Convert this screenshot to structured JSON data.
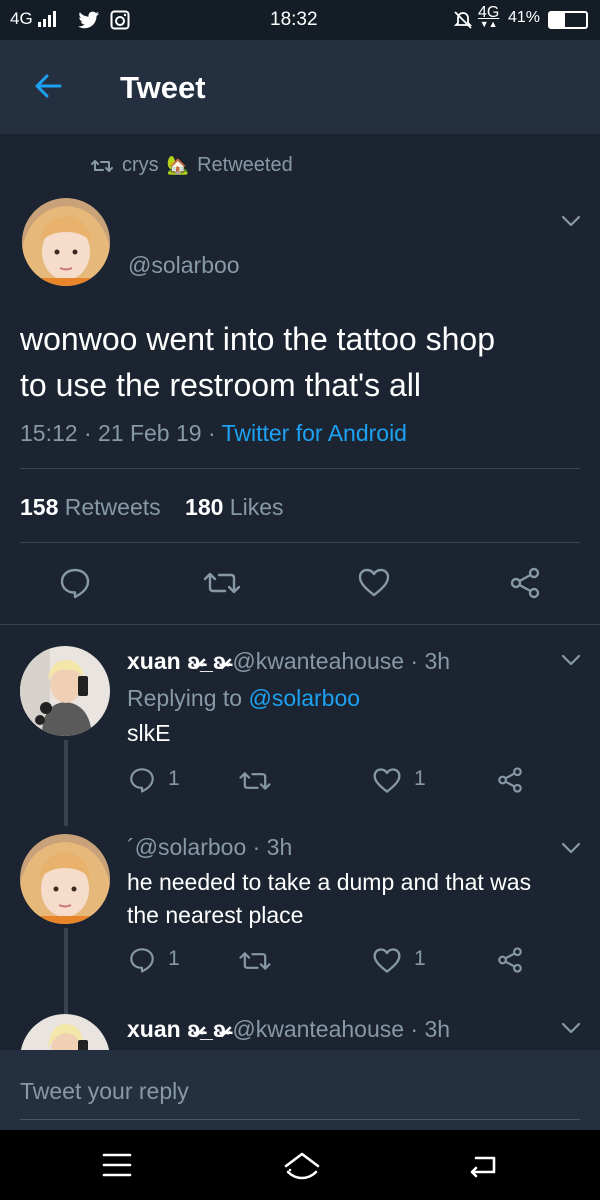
{
  "status_bar": {
    "network_left": "4G",
    "time": "18:32",
    "network_right": "4G",
    "battery": "41%"
  },
  "header": {
    "title": "Tweet"
  },
  "retweet_context": {
    "user": "crys",
    "emoji": "🏡",
    "label": "Retweeted"
  },
  "tweet": {
    "handle": "@solarboo",
    "text_line1": "wonwoo went into the tattoo shop",
    "text_line2": "to use the restroom that's all",
    "time_date": "15:12 · 21 Feb 19 · ",
    "source": "Twitter for Android",
    "retweets_count": "158",
    "retweets_label": "Retweets",
    "likes_count": "180",
    "likes_label": "Likes"
  },
  "replies": [
    {
      "name": "xuan ʚ̴̶̷̷_ʚ̴̶̷̷",
      "handle": "@kwanteahouse · 3h",
      "replying_prefix": "Replying to ",
      "replying_handle": "@solarboo",
      "text": "slkE",
      "reply_count": "1",
      "like_count": "1"
    },
    {
      "handle": "´@solarboo · 3h",
      "text_line1": "he needed to take a dump and that was",
      "text_line2": "the nearest place",
      "reply_count": "1",
      "like_count": "1"
    },
    {
      "name": "xuan ʚ̴̶̷̷_ʚ̴̶̷̷",
      "handle": "@kwanteahouse · 3h"
    }
  ],
  "compose": {
    "placeholder": "Tweet your reply"
  },
  "colors": {
    "background": "#1b2430",
    "header": "#243040",
    "accent": "#1da1f2",
    "muted": "#8899a6"
  }
}
